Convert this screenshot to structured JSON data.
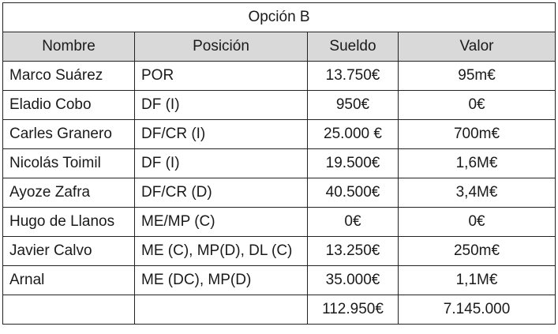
{
  "table": {
    "title": "Opción B",
    "headers": [
      "Nombre",
      "Posición",
      "Sueldo",
      "Valor"
    ],
    "rows": [
      {
        "name": "Marco Suárez",
        "position": "POR",
        "salary": "13.750€",
        "value": "95m€"
      },
      {
        "name": "Eladio Cobo",
        "position": "DF (I)",
        "salary": "950€",
        "value": "0€"
      },
      {
        "name": "Carles Granero",
        "position": "DF/CR (I)",
        "salary": "25.000 €",
        "value": "700m€"
      },
      {
        "name": "Nicolás Toimil",
        "position": "DF (I)",
        "salary": "19.500€",
        "value": "1,6M€"
      },
      {
        "name": "Ayoze Zafra",
        "position": "DF/CR (D)",
        "salary": "40.500€",
        "value": "3,4M€"
      },
      {
        "name": "Hugo de Llanos",
        "position": "ME/MP (C)",
        "salary": "0€",
        "value": "0€"
      },
      {
        "name": "Javier Calvo",
        "position": "ME (C), MP(D), DL (C)",
        "salary": "13.250€",
        "value": "250m€"
      },
      {
        "name": "Arnal",
        "position": "ME (DC), MP(D)",
        "salary": "35.000€",
        "value": "1,1M€"
      }
    ],
    "totals": {
      "name": "",
      "position": "",
      "salary": "112.950€",
      "value": "7.145.000"
    }
  }
}
